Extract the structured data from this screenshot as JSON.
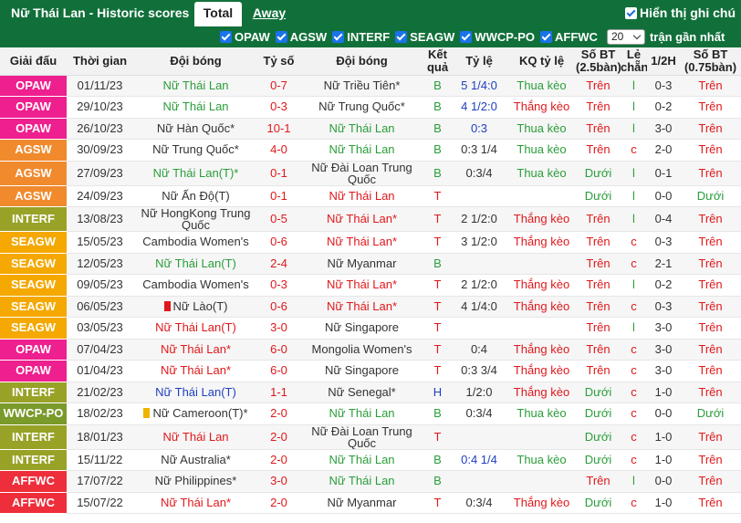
{
  "header": {
    "title": "Nữ Thái Lan - Historic scores",
    "tabs": [
      "Total",
      "Away"
    ],
    "show_notes_label": "Hiển thị ghi chú"
  },
  "filters": {
    "items": [
      "OPAW",
      "AGSW",
      "INTERF",
      "SEAGW",
      "WWCP-PO",
      "AFFWC"
    ],
    "count_value": "20",
    "recent_label": "trận gần nhất"
  },
  "columns": [
    "Giải đấu",
    "Thời gian",
    "Đội bóng",
    "Tỷ số",
    "Đội bóng",
    "Kết quả",
    "Tỷ lệ",
    "KQ tỷ lệ",
    "Số BT (2.5bàn)",
    "Lẻ chẵn",
    "1/2H",
    "Số BT (0.75bàn)"
  ],
  "colors": {
    "OPAW": "#ee1f8f",
    "AGSW": "#f08a2d",
    "INTERF": "#98a227",
    "SEAGW": "#f4a800",
    "WWCP-PO": "#7a9a2a",
    "AFFWC": "#ee2e3a",
    "header_green": "#11703a"
  },
  "rows": [
    {
      "league": "OPAW",
      "date": "01/11/23",
      "home": "Nữ Thái Lan",
      "hc": "green",
      "score": "0-7",
      "away": "Nữ Triều Tiên*",
      "ac": "home",
      "res": "B",
      "odds": "5 1/4:0",
      "oc": "blue",
      "kq": "Thua kèo",
      "kc": "green",
      "bt": "Trên",
      "bc": "red",
      "lc": "l",
      "lcc": "green",
      "half": "0-3",
      "bt2": "Trên",
      "b2c": "red"
    },
    {
      "league": "OPAW",
      "date": "29/10/23",
      "home": "Nữ Thái Lan",
      "hc": "green",
      "score": "0-3",
      "away": "Nữ Trung Quốc*",
      "ac": "home",
      "res": "B",
      "odds": "4 1/2:0",
      "oc": "blue",
      "kq": "Thắng kèo",
      "kc": "red",
      "bt": "Trên",
      "bc": "red",
      "lc": "l",
      "lcc": "green",
      "half": "0-2",
      "bt2": "Trên",
      "b2c": "red"
    },
    {
      "league": "OPAW",
      "date": "26/10/23",
      "home": "Nữ Hàn Quốc*",
      "hc": "home",
      "score": "10-1",
      "away": "Nữ Thái Lan",
      "ac": "green",
      "res": "B",
      "odds": "0:3",
      "oc": "blue",
      "kq": "Thua kèo",
      "kc": "green",
      "bt": "Trên",
      "bc": "red",
      "lc": "l",
      "lcc": "green",
      "half": "3-0",
      "bt2": "Trên",
      "b2c": "red"
    },
    {
      "league": "AGSW",
      "date": "30/09/23",
      "home": "Nữ Trung Quốc*",
      "hc": "home",
      "score": "4-0",
      "away": "Nữ Thái Lan",
      "ac": "green",
      "res": "B",
      "odds": "0:3 1/4",
      "oc": "home",
      "kq": "Thua kèo",
      "kc": "green",
      "bt": "Trên",
      "bc": "red",
      "lc": "c",
      "lcc": "red",
      "half": "2-0",
      "bt2": "Trên",
      "b2c": "red"
    },
    {
      "league": "AGSW",
      "date": "27/09/23",
      "home": "Nữ Thái Lan(T)*",
      "hc": "green",
      "score": "0-1",
      "away": "Nữ Đài Loan Trung Quốc",
      "ac": "home",
      "res": "B",
      "odds": "0:3/4",
      "oc": "home",
      "kq": "Thua kèo",
      "kc": "green",
      "bt": "Dưới",
      "bc": "green",
      "lc": "l",
      "lcc": "green",
      "half": "0-1",
      "bt2": "Trên",
      "b2c": "red"
    },
    {
      "league": "AGSW",
      "date": "24/09/23",
      "home": "Nữ Ấn Độ(T)",
      "hc": "home",
      "score": "0-1",
      "away": "Nữ Thái Lan",
      "ac": "red",
      "res": "T",
      "odds": "",
      "oc": "home",
      "kq": "",
      "kc": "green",
      "bt": "Dưới",
      "bc": "green",
      "lc": "l",
      "lcc": "green",
      "half": "0-0",
      "bt2": "Dưới",
      "b2c": "green"
    },
    {
      "league": "INTERF",
      "date": "13/08/23",
      "home": "Nữ HongKong Trung Quốc",
      "hc": "home",
      "score": "0-5",
      "away": "Nữ Thái Lan*",
      "ac": "red",
      "res": "T",
      "odds": "2 1/2:0",
      "oc": "home",
      "kq": "Thắng kèo",
      "kc": "red",
      "bt": "Trên",
      "bc": "red",
      "lc": "l",
      "lcc": "green",
      "half": "0-4",
      "bt2": "Trên",
      "b2c": "red"
    },
    {
      "league": "SEAGW",
      "date": "15/05/23",
      "home": "Cambodia Women's",
      "hc": "home",
      "score": "0-6",
      "away": "Nữ Thái Lan*",
      "ac": "red",
      "res": "T",
      "odds": "3 1/2:0",
      "oc": "home",
      "kq": "Thắng kèo",
      "kc": "red",
      "bt": "Trên",
      "bc": "red",
      "lc": "c",
      "lcc": "red",
      "half": "0-3",
      "bt2": "Trên",
      "b2c": "red"
    },
    {
      "league": "SEAGW",
      "date": "12/05/23",
      "home": "Nữ Thái Lan(T)",
      "hc": "green",
      "score": "2-4",
      "away": "Nữ Myanmar",
      "ac": "home",
      "res": "B",
      "odds": "",
      "oc": "home",
      "kq": "",
      "kc": "green",
      "bt": "Trên",
      "bc": "red",
      "lc": "c",
      "lcc": "red",
      "half": "2-1",
      "bt2": "Trên",
      "b2c": "red"
    },
    {
      "league": "SEAGW",
      "date": "09/05/23",
      "home": "Cambodia Women's",
      "hc": "home",
      "score": "0-3",
      "away": "Nữ Thái Lan*",
      "ac": "red",
      "res": "T",
      "odds": "2 1/2:0",
      "oc": "home",
      "kq": "Thắng kèo",
      "kc": "red",
      "bt": "Trên",
      "bc": "red",
      "lc": "l",
      "lcc": "green",
      "half": "0-2",
      "bt2": "Trên",
      "b2c": "red"
    },
    {
      "league": "SEAGW",
      "date": "06/05/23",
      "home": "Nữ Lào(T)",
      "hc": "home",
      "flag": "red",
      "score": "0-6",
      "away": "Nữ Thái Lan*",
      "ac": "red",
      "res": "T",
      "odds": "4 1/4:0",
      "oc": "home",
      "kq": "Thắng kèo",
      "kc": "red",
      "bt": "Trên",
      "bc": "red",
      "lc": "c",
      "lcc": "red",
      "half": "0-3",
      "bt2": "Trên",
      "b2c": "red"
    },
    {
      "league": "SEAGW",
      "date": "03/05/23",
      "home": "Nữ Thái Lan(T)",
      "hc": "red",
      "score": "3-0",
      "away": "Nữ Singapore",
      "ac": "home",
      "res": "T",
      "odds": "",
      "oc": "home",
      "kq": "",
      "kc": "green",
      "bt": "Trên",
      "bc": "red",
      "lc": "l",
      "lcc": "green",
      "half": "3-0",
      "bt2": "Trên",
      "b2c": "red"
    },
    {
      "league": "OPAW",
      "date": "07/04/23",
      "home": "Nữ Thái Lan*",
      "hc": "red",
      "score": "6-0",
      "away": "Mongolia Women's",
      "ac": "home",
      "res": "T",
      "odds": "0:4",
      "oc": "home",
      "kq": "Thắng kèo",
      "kc": "red",
      "bt": "Trên",
      "bc": "red",
      "lc": "c",
      "lcc": "red",
      "half": "3-0",
      "bt2": "Trên",
      "b2c": "red"
    },
    {
      "league": "OPAW",
      "date": "01/04/23",
      "home": "Nữ Thái Lan*",
      "hc": "red",
      "score": "6-0",
      "away": "Nữ Singapore",
      "ac": "home",
      "res": "T",
      "odds": "0:3 3/4",
      "oc": "home",
      "kq": "Thắng kèo",
      "kc": "red",
      "bt": "Trên",
      "bc": "red",
      "lc": "c",
      "lcc": "red",
      "half": "3-0",
      "bt2": "Trên",
      "b2c": "red"
    },
    {
      "league": "INTERF",
      "date": "21/02/23",
      "home": "Nữ Thái Lan(T)",
      "hc": "blue",
      "score": "1-1",
      "away": "Nữ Senegal*",
      "ac": "home",
      "res": "H",
      "odds": "1/2:0",
      "oc": "home",
      "kq": "Thắng kèo",
      "kc": "red",
      "bt": "Dưới",
      "bc": "green",
      "lc": "c",
      "lcc": "red",
      "half": "1-0",
      "bt2": "Trên",
      "b2c": "red"
    },
    {
      "league": "WWCP-PO",
      "date": "18/02/23",
      "home": "Nữ Cameroon(T)*",
      "hc": "home",
      "flag": "yellow",
      "score": "2-0",
      "away": "Nữ Thái Lan",
      "ac": "green",
      "res": "B",
      "odds": "0:3/4",
      "oc": "home",
      "kq": "Thua kèo",
      "kc": "green",
      "bt": "Dưới",
      "bc": "green",
      "lc": "c",
      "lcc": "red",
      "half": "0-0",
      "bt2": "Dưới",
      "b2c": "green"
    },
    {
      "league": "INTERF",
      "date": "18/01/23",
      "home": "Nữ Thái Lan",
      "hc": "red",
      "score": "2-0",
      "away": "Nữ Đài Loan Trung Quốc",
      "ac": "home",
      "res": "T",
      "odds": "",
      "oc": "home",
      "kq": "",
      "kc": "green",
      "bt": "Dưới",
      "bc": "green",
      "lc": "c",
      "lcc": "red",
      "half": "1-0",
      "bt2": "Trên",
      "b2c": "red"
    },
    {
      "league": "INTERF",
      "date": "15/11/22",
      "home": "Nữ Australia*",
      "hc": "home",
      "score": "2-0",
      "away": "Nữ Thái Lan",
      "ac": "green",
      "res": "B",
      "odds": "0:4 1/4",
      "oc": "blue",
      "kq": "Thua kèo",
      "kc": "green",
      "bt": "Dưới",
      "bc": "green",
      "lc": "c",
      "lcc": "red",
      "half": "1-0",
      "bt2": "Trên",
      "b2c": "red"
    },
    {
      "league": "AFFWC",
      "date": "17/07/22",
      "home": "Nữ Philippines*",
      "hc": "home",
      "score": "3-0",
      "away": "Nữ Thái Lan",
      "ac": "green",
      "res": "B",
      "odds": "",
      "oc": "home",
      "kq": "",
      "kc": "green",
      "bt": "Trên",
      "bc": "red",
      "lc": "l",
      "lcc": "green",
      "half": "0-0",
      "bt2": "Trên",
      "b2c": "red"
    },
    {
      "league": "AFFWC",
      "date": "15/07/22",
      "home": "Nữ Thái Lan*",
      "hc": "red",
      "score": "2-0",
      "away": "Nữ Myanmar",
      "ac": "home",
      "res": "T",
      "odds": "0:3/4",
      "oc": "home",
      "kq": "Thắng kèo",
      "kc": "red",
      "bt": "Dưới",
      "bc": "green",
      "lc": "c",
      "lcc": "red",
      "half": "1-0",
      "bt2": "Trên",
      "b2c": "red"
    }
  ]
}
